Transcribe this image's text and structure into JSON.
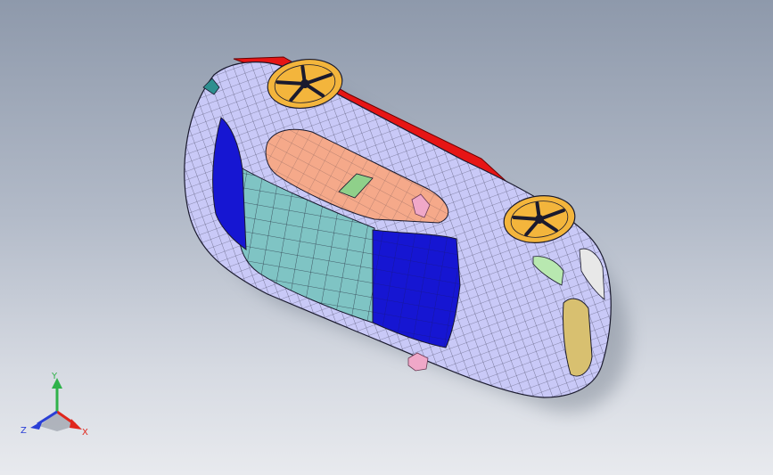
{
  "viewport": {
    "background_top": "#8e99ab",
    "background_bottom": "#e8eaee"
  },
  "model": {
    "body_color": "#c9c9f7",
    "mesh_color": "#1a1a2e",
    "roof_color": "#7fc4c4",
    "blue_panel_color": "#1616d2",
    "window_color": "#f5a98a",
    "trim_color": "#e61515",
    "wheel_color": "#f3b53c",
    "wheel_icon": "wheel-rim-icon",
    "part_color": "#f0a8c8"
  },
  "triad": {
    "y_label": "Y",
    "x_label": "X",
    "z_label": "Z",
    "y_color": "#2fb24a",
    "x_color": "#e0261c",
    "z_color": "#2a3fd6"
  }
}
